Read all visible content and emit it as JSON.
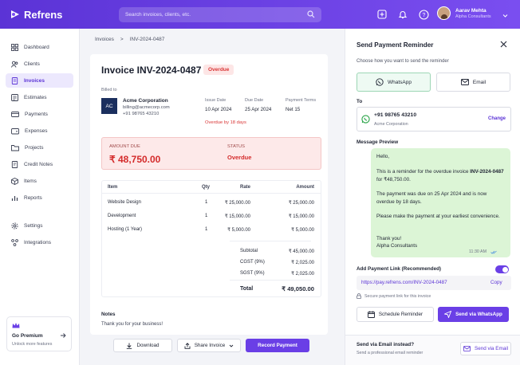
{
  "topbar": {
    "brand": "Refrens",
    "search_placeholder": "Search invoices, clients, etc.",
    "icons": [
      "plus-square-icon",
      "bell-icon",
      "help-icon"
    ],
    "user_name": "Aarav Mehta",
    "user_company": "Alpha Consultants"
  },
  "sidebar": {
    "items": [
      {
        "label": "Dashboard",
        "icon": "dashboard-icon"
      },
      {
        "label": "Clients",
        "icon": "users-icon"
      },
      {
        "label": "Invoices",
        "icon": "invoice-icon",
        "active": true
      },
      {
        "label": "Estimates",
        "icon": "estimate-icon"
      },
      {
        "label": "Payments",
        "icon": "card-icon"
      },
      {
        "label": "Expenses",
        "icon": "wallet-icon"
      },
      {
        "label": "Projects",
        "icon": "folder-icon"
      },
      {
        "label": "Credit Notes",
        "icon": "note-icon"
      },
      {
        "label": "Items",
        "icon": "box-icon"
      },
      {
        "label": "Reports",
        "icon": "bar-chart-icon"
      },
      {
        "label": "Settings",
        "icon": "gear-icon"
      },
      {
        "label": "Integrations",
        "icon": "integrations-icon"
      }
    ],
    "premium": {
      "title": "Go Premium",
      "subtitle": "Unlock more features"
    }
  },
  "breadcrumb": {
    "parent": "Invoices",
    "sep": ">",
    "current": "INV-2024-0487"
  },
  "invoice": {
    "title": "Invoice INV-2024-0487",
    "status_badge": "Overdue",
    "billed_to_label": "Billed to",
    "client_initials": "AC",
    "client_name": "Acme Corporation",
    "client_email": "billing@acmecorp.com",
    "client_phone": "+91 98765 43210",
    "issue_date_label": "Issue Date",
    "issue_date": "10 Apr 2024",
    "due_date_label": "Due Date",
    "due_date": "25 Apr 2024",
    "terms_label": "Payment Terms",
    "terms": "Net 15",
    "overdue_by": "Overdue by 18 days",
    "amount_due_label": "AMOUNT DUE",
    "amount_due": "₹ 48,750.00",
    "status_label": "STATUS",
    "status": "Overdue",
    "table": {
      "headers": {
        "item": "Item",
        "qty": "Qty",
        "rate": "Rate",
        "amount": "Amount"
      },
      "rows": [
        {
          "item": "Website Design",
          "qty": "1",
          "rate": "₹ 25,000.00",
          "amount": "₹ 25,000.00"
        },
        {
          "item": "Development",
          "qty": "1",
          "rate": "₹ 15,000.00",
          "amount": "₹ 15,000.00"
        },
        {
          "item": "Hosting (1 Year)",
          "qty": "1",
          "rate": "₹ 5,000.00",
          "amount": "₹ 5,000.00"
        }
      ],
      "subtotal_label": "Subtotal",
      "subtotal": "₹ 45,000.00",
      "cgst_label": "CGST (9%)",
      "cgst": "₹ 2,025.00",
      "sgst_label": "SGST (9%)",
      "sgst": "₹ 2,025.00",
      "total_label": "Total",
      "total": "₹ 49,050.00"
    },
    "notes_label": "Notes",
    "notes": "Thank you for your business!",
    "actions": {
      "download": "Download",
      "share": "Share Invoice",
      "record": "Record Payment"
    }
  },
  "panel": {
    "title": "Send Payment Reminder",
    "subtitle": "Choose how you want to send the reminder",
    "channels": {
      "whatsapp": "WhatsApp",
      "email": "Email"
    },
    "to_label": "To",
    "to_number": "+91 98765 43210",
    "to_company": "Acme Corporation",
    "change": "Change",
    "preview_label": "Message Preview",
    "message": {
      "greeting": "Hello,",
      "line1": "This is a reminder for the overdue invoice",
      "invoice_ref": "INV-2024-0487",
      "line1_tail": " for ₹48,750.00.",
      "line2": "The payment was due on 25 Apr 2024 and is now overdue by 18 days.",
      "line3": "Please make the payment at your earliest convenience.",
      "thanks": "Thank you!",
      "sign": "Alpha Consultants",
      "time": "11:30 AM"
    },
    "link_label": "Add Payment Link (Recommended)",
    "link_enabled": true,
    "link_url": "https://pay.refrens.com/INV-2024-0487",
    "copy": "Copy",
    "secure_note": "Secure payment link for this invoice",
    "schedule": "Schedule Reminder",
    "send_whatsapp": "Send via WhatsApp",
    "email_question": "Send via Email instead?",
    "email_sub": "Send a professional email reminder",
    "send_email": "Send via Email"
  },
  "colors": {
    "brand": "#6a3fe6",
    "overdue": "#d93636",
    "whatsapp": "#25a244"
  }
}
